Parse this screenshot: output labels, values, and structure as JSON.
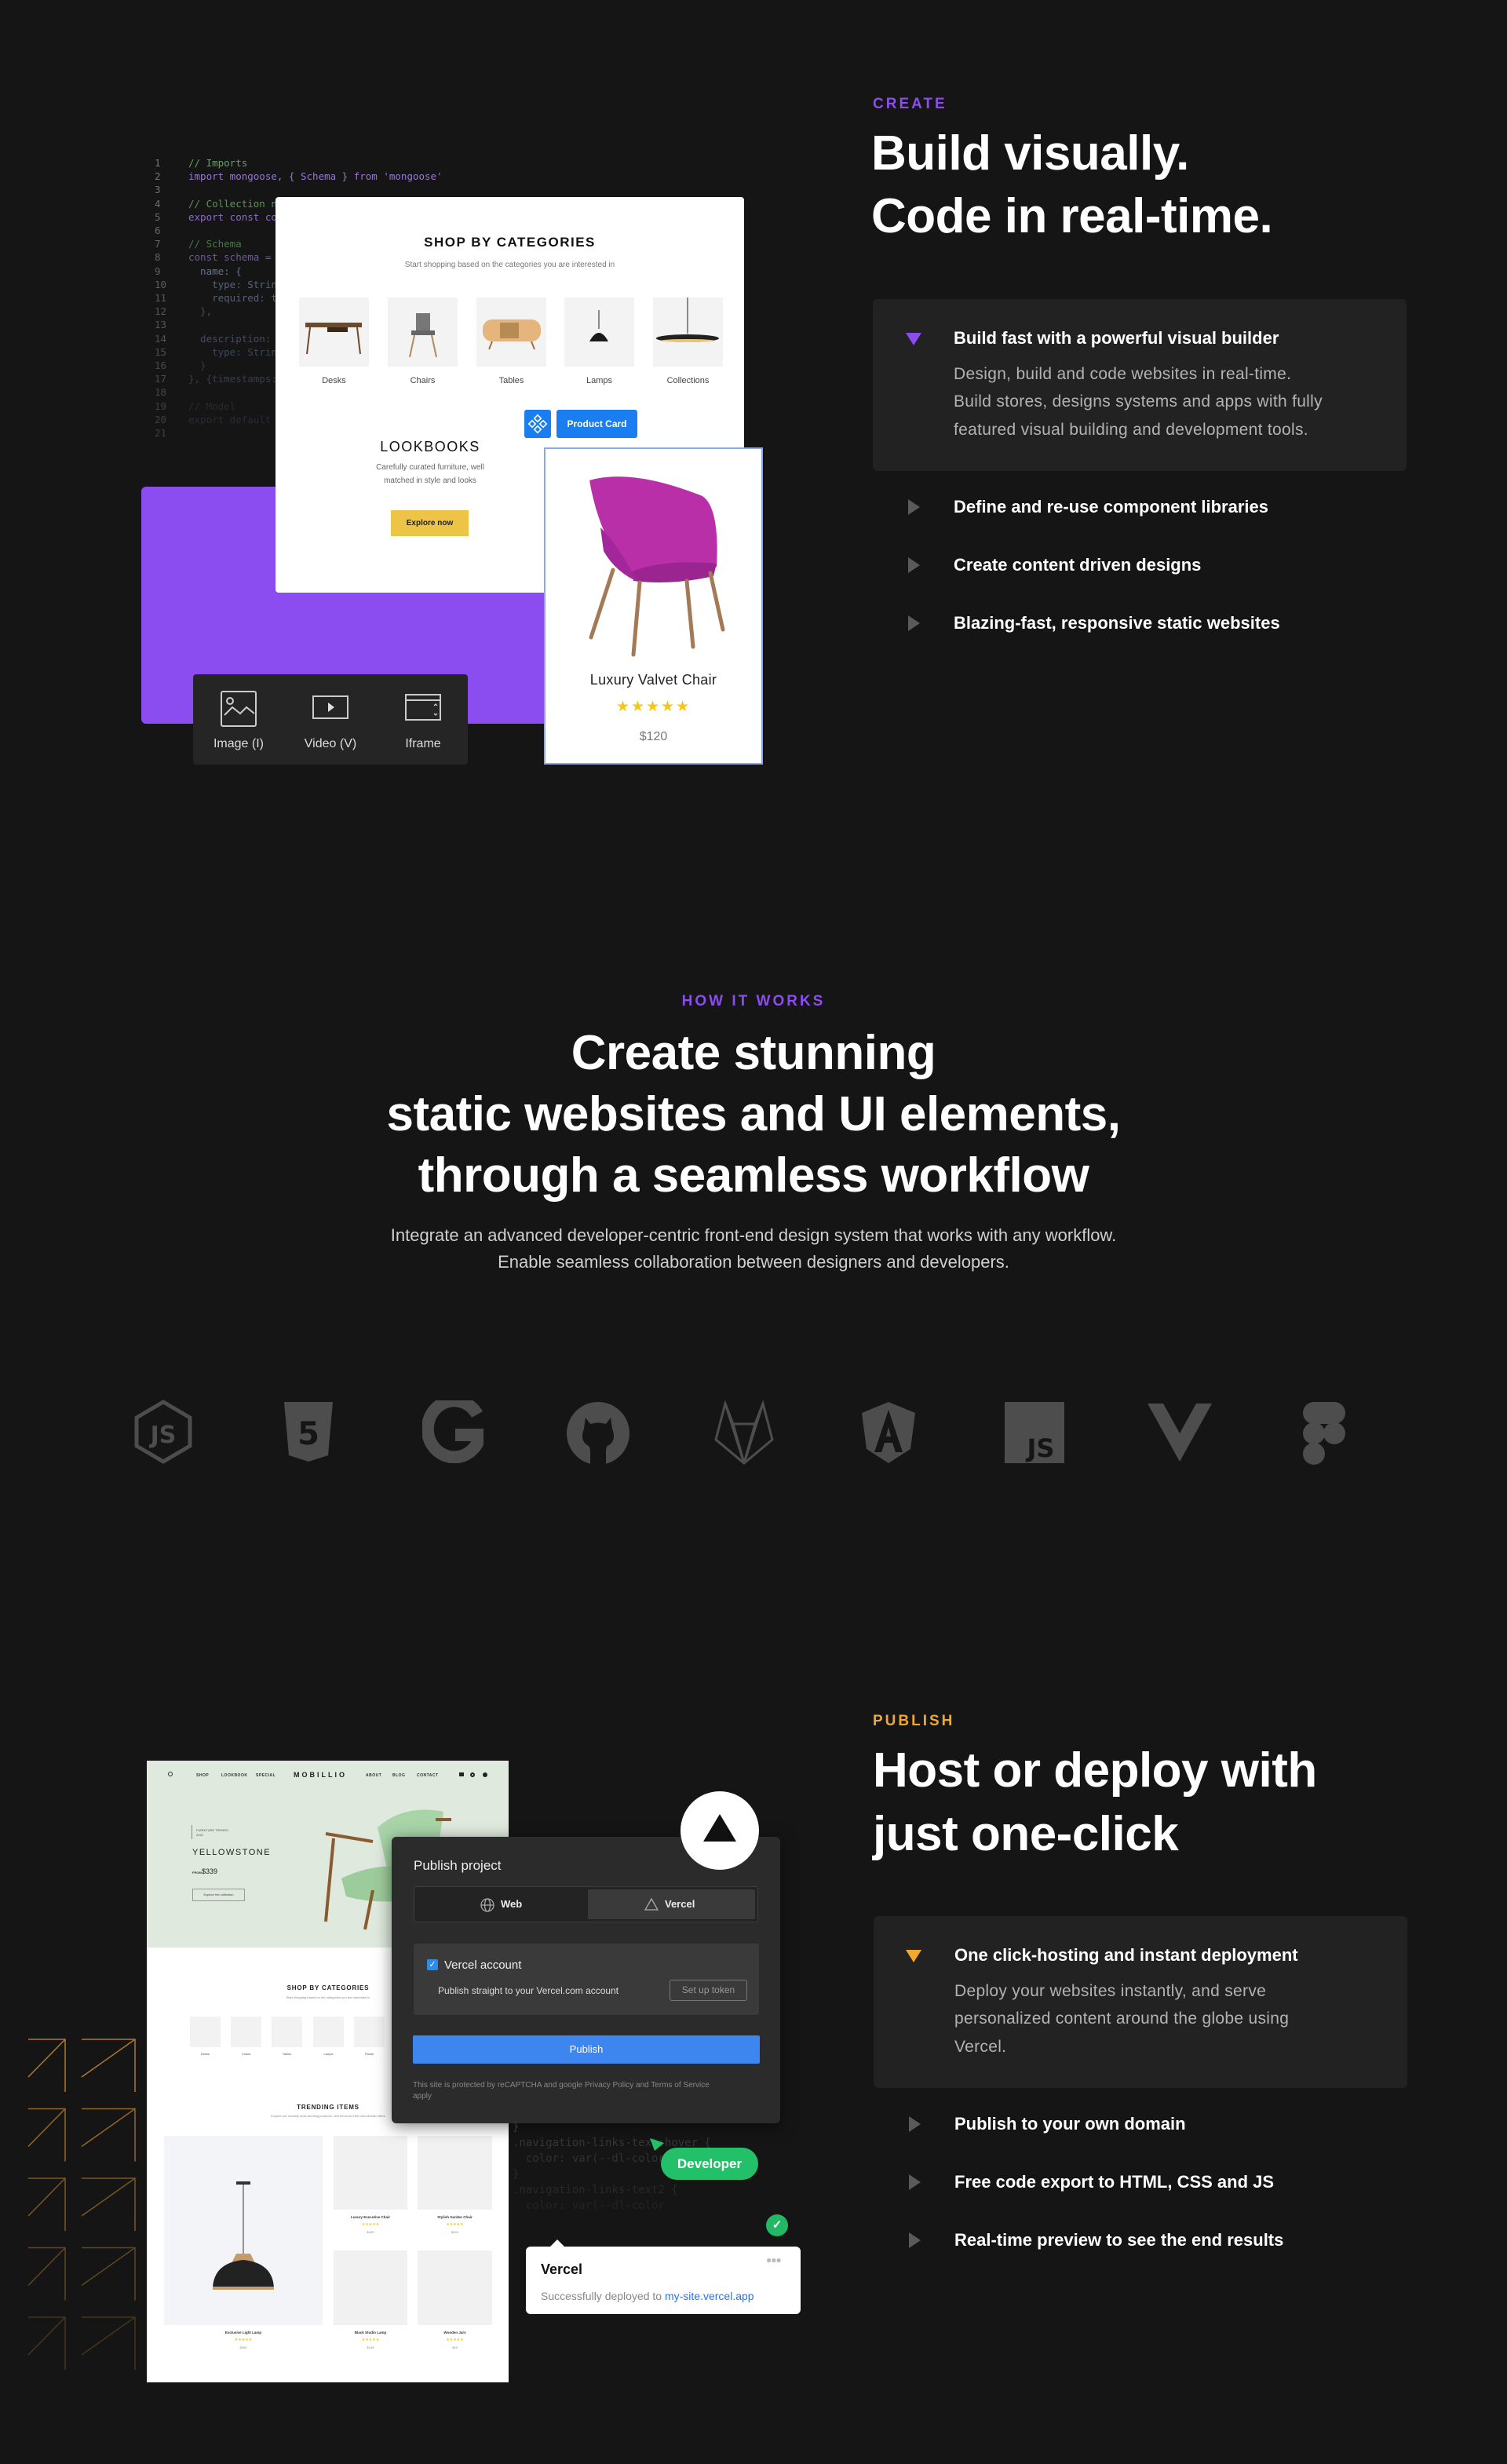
{
  "create": {
    "eyebrow": "CREATE",
    "heading_line1": "Build visually.",
    "heading_line2": "Code in real-time.",
    "accent_color": "#8b4cf0",
    "active_item": {
      "title": "Build fast with a powerful visual builder",
      "desc_lines": [
        "Design, build and code websites in real-time.",
        "Build stores, designs systems and apps with fully",
        "featured visual building and development tools."
      ]
    },
    "items": [
      "Define and re-use component libraries",
      "Create content driven designs",
      "Blazing-fast, responsive static websites"
    ],
    "code_lines": [
      {
        "n": "1",
        "t": "// Imports",
        "c": "#5fa35f"
      },
      {
        "n": "2",
        "t": "import mongoose, { Schema } from 'mongoose'",
        "c": "#9d7ad8"
      },
      {
        "n": "3",
        "t": "",
        "c": "#888"
      },
      {
        "n": "4",
        "t": "// Collection n",
        "c": "#5fa35f"
      },
      {
        "n": "5",
        "t": "export const co",
        "c": "#9d7ad8"
      },
      {
        "n": "6",
        "t": "",
        "c": "#888"
      },
      {
        "n": "7",
        "t": "// Schema",
        "c": "#4f8f4f"
      },
      {
        "n": "8",
        "t": "const schema =",
        "c": "#8a6ac0"
      },
      {
        "n": "9",
        "t": "  name: {",
        "c": "#7b8fb8"
      },
      {
        "n": "10",
        "t": "    type: Strin",
        "c": "#6f7f9f"
      },
      {
        "n": "11",
        "t": "    required: t",
        "c": "#6f7f9f"
      },
      {
        "n": "12",
        "t": "  },",
        "c": "#666"
      },
      {
        "n": "13",
        "t": "",
        "c": "#666"
      },
      {
        "n": "14",
        "t": "  description:",
        "c": "#5f6f8f"
      },
      {
        "n": "15",
        "t": "    type: Strin",
        "c": "#5a6a88"
      },
      {
        "n": "16",
        "t": "  }",
        "c": "#555"
      },
      {
        "n": "17",
        "t": "}, {timestamps:",
        "c": "#55607a"
      },
      {
        "n": "18",
        "t": "",
        "c": "#444"
      },
      {
        "n": "19",
        "t": "// Model",
        "c": "#444"
      },
      {
        "n": "20",
        "t": "export default",
        "c": "#4a4460"
      },
      {
        "n": "21",
        "t": "",
        "c": "#444"
      }
    ],
    "shop": {
      "title": "SHOP BY CATEGORIES",
      "subtitle": "Start shopping based on the categories you are interested in",
      "categories": [
        "Desks",
        "Chairs",
        "Tables",
        "Lamps",
        "Collections"
      ],
      "component_button": "Product Card",
      "lookbooks_title": "LOOKBOOKS",
      "lookbooks_desc_lines": [
        "Carefully curated furniture, well",
        "matched in style and looks"
      ],
      "explore_button": "Explore now"
    },
    "product_card": {
      "name": "Luxury Valvet Chair",
      "rating": 5,
      "price": "$120"
    },
    "toolbar": [
      {
        "label": "Image (I)",
        "icon": "image-icon"
      },
      {
        "label": "Video (V)",
        "icon": "video-icon"
      },
      {
        "label": "Iframe",
        "icon": "iframe-icon"
      }
    ]
  },
  "how": {
    "eyebrow": "HOW IT WORKS",
    "heading_lines": [
      "Create stunning",
      "static websites and UI elements,",
      "through a seamless workflow"
    ],
    "paragraph_lines": [
      "Integrate an advanced developer-centric front-end design system that works with any workflow.",
      "Enable seamless collaboration between designers and developers."
    ],
    "logos": [
      "nodejs-icon",
      "html5-icon",
      "google-icon",
      "github-icon",
      "gitlab-icon",
      "angular-icon",
      "javascript-icon",
      "vue-icon",
      "figma-icon"
    ]
  },
  "publish": {
    "eyebrow": "PUBLISH",
    "accent_color": "#f0a92e",
    "heading_line1": "Host or deploy with",
    "heading_line2": "just one-click",
    "active_item": {
      "title": "One click-hosting and instant deployment",
      "desc_lines": [
        "Deploy your websites instantly, and serve",
        "personalized content around the globe using",
        "Vercel."
      ]
    },
    "items": [
      "Publish to your own domain",
      "Free code export to HTML, CSS and JS",
      "Real-time preview to see the end results"
    ],
    "site": {
      "nav_left": [
        "SHOP",
        "LOOKBOOK",
        "SPECIAL"
      ],
      "brand": "MOBILLIO",
      "nav_right": [
        "ABOUT",
        "BLOG",
        "CONTACT"
      ],
      "hero_label": "FURNITURE TRENDS · 2022",
      "hero_title": "YELLOWSTONE",
      "hero_from": "FROM",
      "hero_price": "$339",
      "hero_button": "Explore the collection",
      "categories_title": "SHOP BY CATEGORIES",
      "categories_subtitle": "Start shopping based on the categories you are interested in",
      "categories": [
        "Desks",
        "Chairs",
        "Tables",
        "Lamps",
        "Plants"
      ],
      "trending_title": "TRENDING ITEMS",
      "trending_subtitle": "Explore our monthly most trending products, new items and the best Mobilio offers",
      "products": [
        {
          "name": "Exclusive Light Lamp",
          "price": "$390"
        },
        {
          "name": "Luxury Executive Chair",
          "price": "$429"
        },
        {
          "name": "Stylish Garden Chair",
          "price": "$299"
        },
        {
          "name": "Black Studio Lamp",
          "price": "$149"
        },
        {
          "name": "Wooden Jars",
          "price": "$49"
        }
      ]
    },
    "dialog": {
      "title": "Publish project",
      "tab_web": "Web",
      "tab_vercel": "Vercel",
      "account_title": "Vercel account",
      "account_checked": true,
      "account_desc": "Publish straight to your Vercel.com account",
      "token_button": "Set up token",
      "publish_button": "Publish",
      "footnote_line1": "This site is protected by reCAPTCHA and google Privacy Policy and Terms of Service",
      "footnote_line2": "apply"
    },
    "code_lines": [
      "}",
      ".navigation-links-text:hover {",
      "  color: var(--dl-color",
      "}",
      ".navigation-links-text2 {",
      "  color: var(--dl-color"
    ],
    "developer_badge": "Developer",
    "toast": {
      "title": "Vercel",
      "message": "Successfully deployed to ",
      "link": "my-site.vercel.app"
    }
  }
}
